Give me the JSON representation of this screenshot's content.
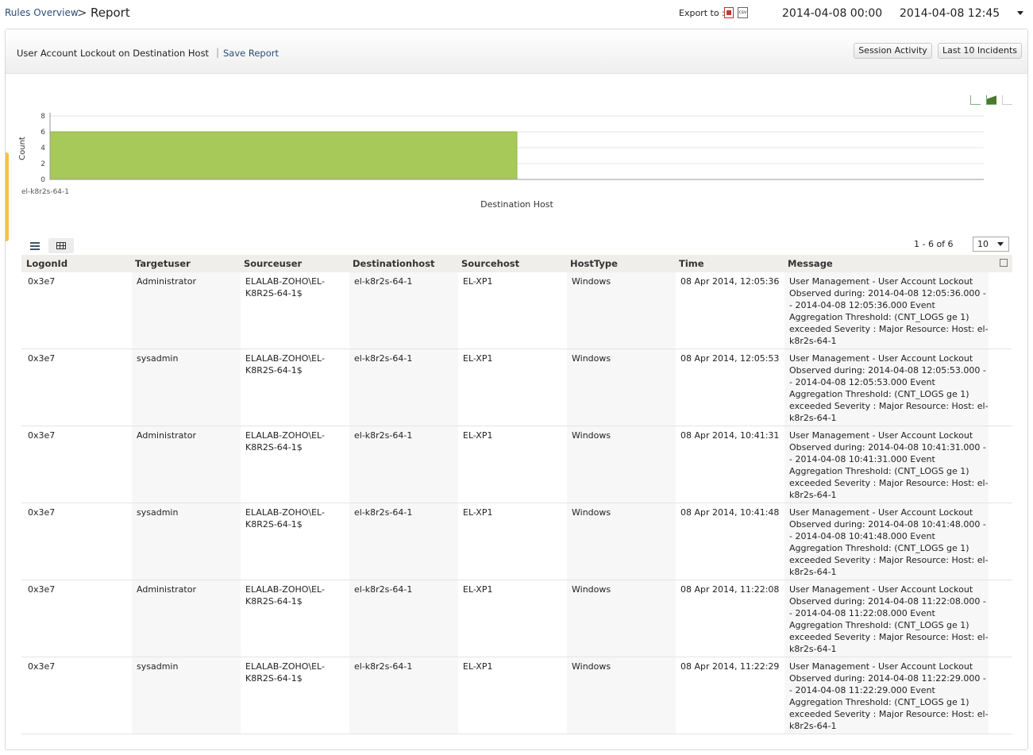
{
  "breadcrumb": {
    "parent": "Rules Overview",
    "separator": ">",
    "current": "Report"
  },
  "export": {
    "label": "Export to :",
    "pdf_text": "",
    "csv_text": "csv"
  },
  "date_range": {
    "from": "2014-04-08 00:00",
    "to": "2014-04-08 12:45"
  },
  "report": {
    "name": "User Account Lockout on Destination Host",
    "separator": "|",
    "save_label": "Save Report",
    "buttons": {
      "session_activity": "Session Activity",
      "last_incidents": "Last 10 Incidents"
    }
  },
  "chart_data": {
    "type": "bar",
    "categories": [
      "el-k8r2s-64-1"
    ],
    "values": [
      6
    ],
    "xlabel": "Destination Host",
    "ylabel": "Count",
    "ylim": [
      0,
      8
    ],
    "yticks": [
      0,
      2,
      4,
      6,
      8
    ],
    "grid": true,
    "bar_color": "#a7c95a"
  },
  "table": {
    "paging": "1 - 6 of 6",
    "page_size": "10",
    "columns": [
      "LogonId",
      "Targetuser",
      "Sourceuser",
      "Destinationhost",
      "Sourcehost",
      "HostType",
      "Time",
      "Message"
    ],
    "rows": [
      {
        "logonid": "0x3e7",
        "targetuser": "Administrator",
        "sourceuser": [
          "ELALAB-ZOHO\\EL-",
          "K8R2S-64-1$"
        ],
        "destinationhost": "el-k8r2s-64-1",
        "sourcehost": "EL-XP1",
        "hosttype": "Windows",
        "time": "08 Apr 2014, 12:05:36",
        "message": [
          "User Management - User Account Lockout",
          "Observed during: 2014-04-08 12:05:36.000 -",
          "- 2014-04-08 12:05:36.000 Event",
          "Aggregation Threshold: (CNT_LOGS ge 1)",
          "exceeded Severity : Major Resource: Host: el-",
          "k8r2s-64-1"
        ]
      },
      {
        "logonid": "0x3e7",
        "targetuser": "sysadmin",
        "sourceuser": [
          "ELALAB-ZOHO\\EL-",
          "K8R2S-64-1$"
        ],
        "destinationhost": "el-k8r2s-64-1",
        "sourcehost": "EL-XP1",
        "hosttype": "Windows",
        "time": "08 Apr 2014, 12:05:53",
        "message": [
          "User Management - User Account Lockout",
          "Observed during: 2014-04-08 12:05:53.000 -",
          "- 2014-04-08 12:05:53.000 Event",
          "Aggregation Threshold: (CNT_LOGS ge 1)",
          "exceeded Severity : Major Resource: Host: el-",
          "k8r2s-64-1"
        ]
      },
      {
        "logonid": "0x3e7",
        "targetuser": "Administrator",
        "sourceuser": [
          "ELALAB-ZOHO\\EL-",
          "K8R2S-64-1$"
        ],
        "destinationhost": "el-k8r2s-64-1",
        "sourcehost": "EL-XP1",
        "hosttype": "Windows",
        "time": "08 Apr 2014, 10:41:31",
        "message": [
          "User Management - User Account Lockout",
          "Observed during: 2014-04-08 10:41:31.000 -",
          "- 2014-04-08 10:41:31.000 Event",
          "Aggregation Threshold: (CNT_LOGS ge 1)",
          "exceeded Severity : Major Resource: Host: el-",
          "k8r2s-64-1"
        ]
      },
      {
        "logonid": "0x3e7",
        "targetuser": "sysadmin",
        "sourceuser": [
          "ELALAB-ZOHO\\EL-",
          "K8R2S-64-1$"
        ],
        "destinationhost": "el-k8r2s-64-1",
        "sourcehost": "EL-XP1",
        "hosttype": "Windows",
        "time": "08 Apr 2014, 10:41:48",
        "message": [
          "User Management - User Account Lockout",
          "Observed during: 2014-04-08 10:41:48.000 -",
          "- 2014-04-08 10:41:48.000 Event",
          "Aggregation Threshold: (CNT_LOGS ge 1)",
          "exceeded Severity : Major Resource: Host: el-",
          "k8r2s-64-1"
        ]
      },
      {
        "logonid": "0x3e7",
        "targetuser": "Administrator",
        "sourceuser": [
          "ELALAB-ZOHO\\EL-",
          "K8R2S-64-1$"
        ],
        "destinationhost": "el-k8r2s-64-1",
        "sourcehost": "EL-XP1",
        "hosttype": "Windows",
        "time": "08 Apr 2014, 11:22:08",
        "message": [
          "User Management - User Account Lockout",
          "Observed during: 2014-04-08 11:22:08.000 -",
          "- 2014-04-08 11:22:08.000 Event",
          "Aggregation Threshold: (CNT_LOGS ge 1)",
          "exceeded Severity : Major Resource: Host: el-",
          "k8r2s-64-1"
        ]
      },
      {
        "logonid": "0x3e7",
        "targetuser": "sysadmin",
        "sourceuser": [
          "ELALAB-ZOHO\\EL-",
          "K8R2S-64-1$"
        ],
        "destinationhost": "el-k8r2s-64-1",
        "sourcehost": "EL-XP1",
        "hosttype": "Windows",
        "time": "08 Apr 2014, 11:22:29",
        "message": [
          "User Management - User Account Lockout",
          "Observed during: 2014-04-08 11:22:29.000 -",
          "- 2014-04-08 11:22:29.000 Event",
          "Aggregation Threshold: (CNT_LOGS ge 1)",
          "exceeded Severity : Major Resource: Host: el-",
          "k8r2s-64-1"
        ]
      }
    ]
  }
}
